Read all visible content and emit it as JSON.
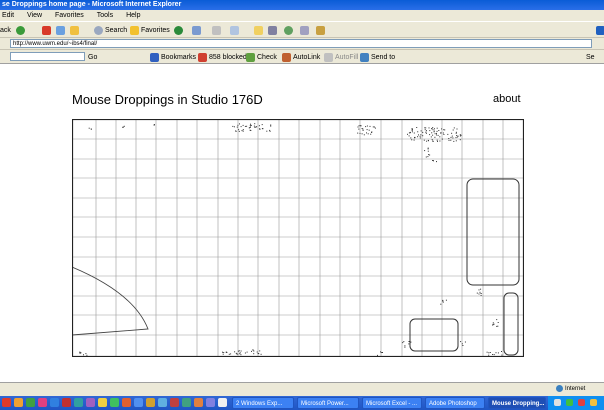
{
  "window": {
    "title": "se Droppings home page - Microsoft Internet Explorer"
  },
  "menu": [
    "Edit",
    "View",
    "Favorites",
    "Tools",
    "Help"
  ],
  "toolbar": {
    "back": "ack",
    "search": "Search",
    "favorites": "Favorites"
  },
  "address": {
    "value": "http://www.uwm.edu/~ibs4/final/"
  },
  "google_bar": {
    "go": "Go",
    "bookmarks": "Bookmarks",
    "blocked": "858 blocked",
    "check": "Check",
    "autolink": "AutoLink",
    "autofill": "AutoFill",
    "send_to": "Send to",
    "search_label": "Se"
  },
  "page": {
    "title": "Mouse Droppings in Studio 176D",
    "about": "about"
  },
  "status": {
    "zone": "Internet"
  },
  "taskbar": {
    "tasks": [
      "2 Windows Exp...",
      "Microsoft Power...",
      "Microsoft Excel - ...",
      "Adobe Photoshop",
      "Mouse Dropping..."
    ]
  },
  "colors": {
    "title_bar": "#0a5cd6",
    "taskbar": "#2a5fd1",
    "grid_line": "#999999"
  }
}
